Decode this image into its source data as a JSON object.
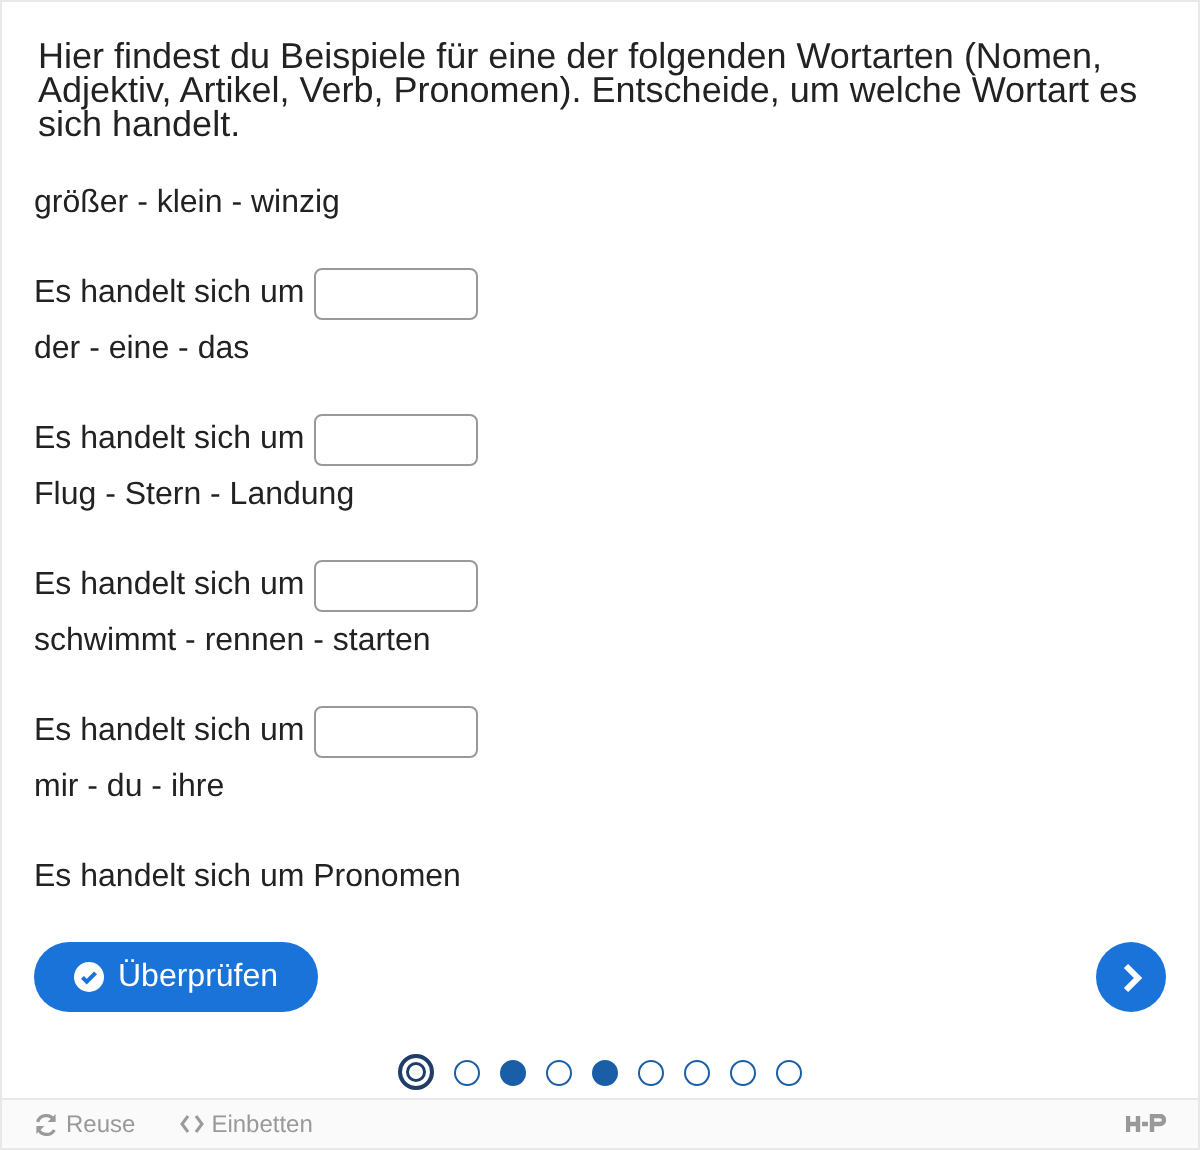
{
  "question": "Hier findest du Beispiele für eine der folgenden Wortarten (Nomen, Adjektiv, Artikel, Verb, Pronomen). Entscheide, um welche Wortart es sich handelt.",
  "items": [
    {
      "words": "größer - klein - winzig",
      "prompt": "Es handelt sich um",
      "kind": "field"
    },
    {
      "words": "der - eine - das",
      "prompt": "Es handelt sich um",
      "kind": "field"
    },
    {
      "words": "Flug - Stern - Landung",
      "prompt": "Es handelt sich um",
      "kind": "field"
    },
    {
      "words": "schwimmt - rennen - starten",
      "prompt": "Es handelt sich um",
      "kind": "field"
    },
    {
      "words": "mir - du - ihre",
      "prompt": "Es handelt sich um Pronomen",
      "kind": "text"
    }
  ],
  "check_button": "Überprüfen",
  "dots": [
    {
      "selected": true,
      "answered": false
    },
    {
      "selected": false,
      "answered": false
    },
    {
      "selected": false,
      "answered": true
    },
    {
      "selected": false,
      "answered": false
    },
    {
      "selected": false,
      "answered": true
    },
    {
      "selected": false,
      "answered": false
    },
    {
      "selected": false,
      "answered": false
    },
    {
      "selected": false,
      "answered": false
    },
    {
      "selected": false,
      "answered": false
    }
  ],
  "footer": {
    "reuse": "Reuse",
    "embed": "Einbetten"
  }
}
